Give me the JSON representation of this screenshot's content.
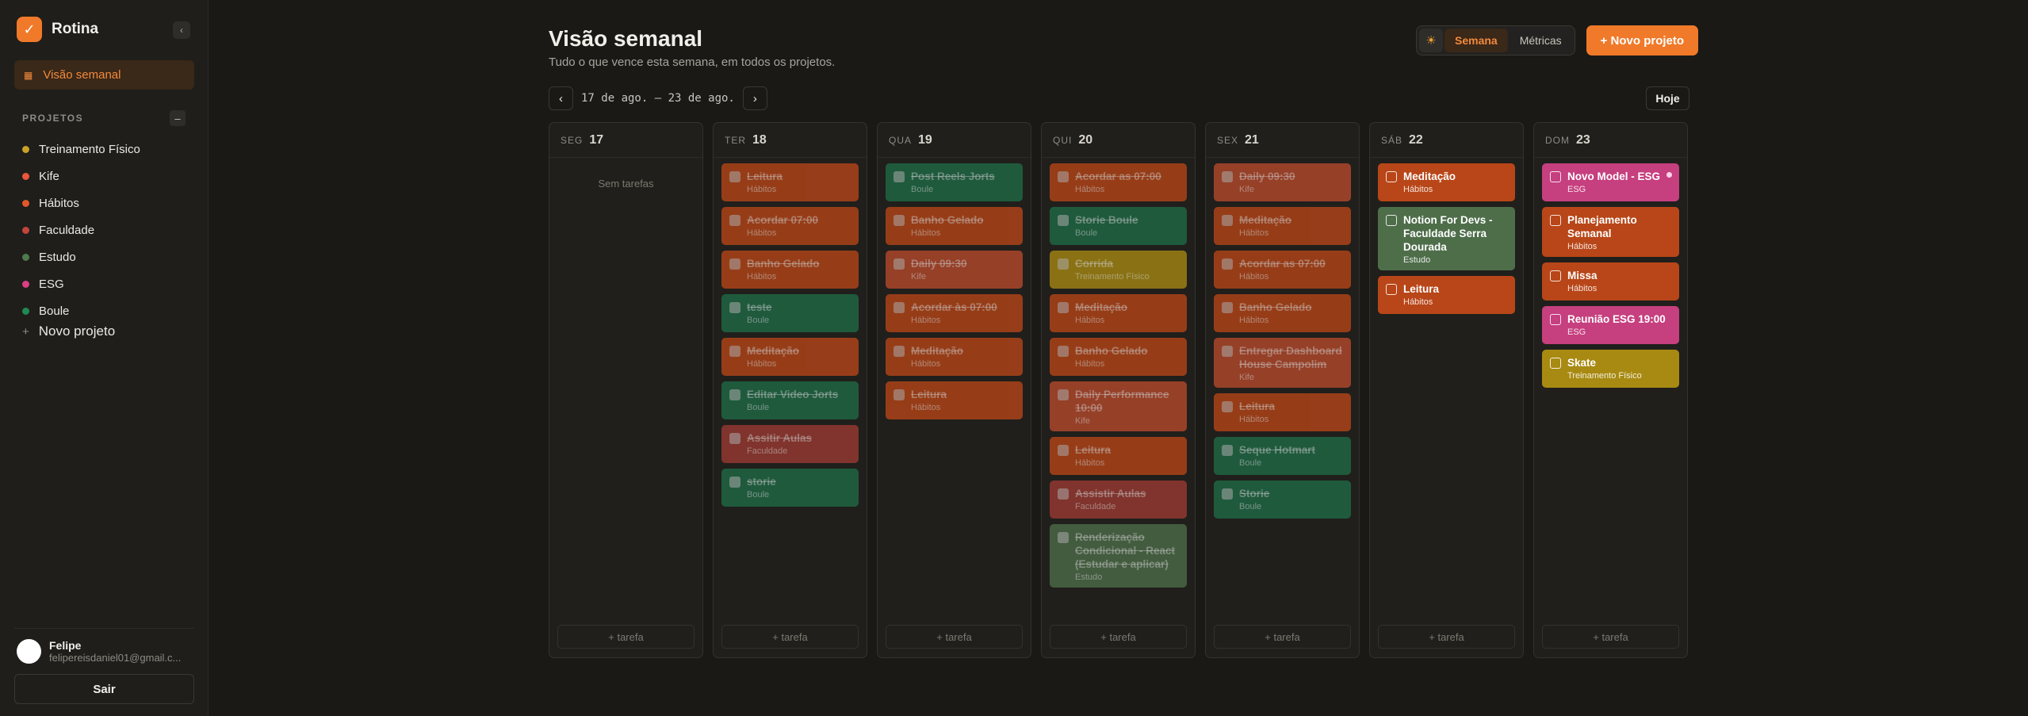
{
  "app": {
    "name": "Rotina",
    "logo_icon": "check-icon"
  },
  "sidebar": {
    "weekly_view_label": "Visão semanal",
    "projects_label": "PROJETOS",
    "projects": [
      {
        "name": "Treinamento Físico",
        "color": "#c9a227"
      },
      {
        "name": "Kife",
        "color": "#e8573a"
      },
      {
        "name": "Hábitos",
        "color": "#e2572a"
      },
      {
        "name": "Faculdade",
        "color": "#c2453d"
      },
      {
        "name": "Estudo",
        "color": "#4e7a4c"
      },
      {
        "name": "ESG",
        "color": "#db3f83"
      },
      {
        "name": "Boule",
        "color": "#1f8a52"
      }
    ],
    "new_project_label": "Novo projeto",
    "user": {
      "name": "Felipe",
      "email": "felipereisdaniel01@gmail.c..."
    },
    "logout_label": "Sair"
  },
  "header": {
    "title": "Visão semanal",
    "subtitle": "Tudo o que vence esta semana, em todos os projetos.",
    "tabs": [
      {
        "label": "Semana",
        "active": true
      },
      {
        "label": "Métricas",
        "active": false
      }
    ],
    "new_project_button": "+ Novo projeto",
    "range": "17 de ago. — 23 de ago.",
    "today_button": "Hoje"
  },
  "project_colors": {
    "Hábitos": "#b84618",
    "Boule": "#1f6b47",
    "Kife": "#b84a2c",
    "Faculdade": "#9c3b32",
    "Treinamento Físico": "#a88a12",
    "Estudo": "#4e6e4a",
    "ESG": "#c63f7f"
  },
  "add_task_label": "+ tarefa",
  "empty_label": "Sem tarefas",
  "days": [
    {
      "name": "SEG",
      "num": "17",
      "tasks": []
    },
    {
      "name": "TER",
      "num": "18",
      "tasks": [
        {
          "title": "Leitura",
          "project": "Hábitos",
          "done": true
        },
        {
          "title": "Acordar 07:00",
          "project": "Hábitos",
          "done": true
        },
        {
          "title": "Banho Gelado",
          "project": "Hábitos",
          "done": true
        },
        {
          "title": "teste",
          "project": "Boule",
          "done": true
        },
        {
          "title": "Meditação",
          "project": "Hábitos",
          "done": true
        },
        {
          "title": "Editar Video Jorts",
          "project": "Boule",
          "done": true
        },
        {
          "title": "Assitir Aulas",
          "project": "Faculdade",
          "done": true
        },
        {
          "title": "storie",
          "project": "Boule",
          "done": true
        }
      ]
    },
    {
      "name": "QUA",
      "num": "19",
      "tasks": [
        {
          "title": "Post Reels Jorts",
          "project": "Boule",
          "done": true
        },
        {
          "title": "Banho Gelado",
          "project": "Hábitos",
          "done": true
        },
        {
          "title": "Daily 09:30",
          "project": "Kife",
          "done": true
        },
        {
          "title": "Acordar às 07:00",
          "project": "Hábitos",
          "done": true
        },
        {
          "title": "Meditação",
          "project": "Hábitos",
          "done": true
        },
        {
          "title": "Leitura",
          "project": "Hábitos",
          "done": true
        }
      ]
    },
    {
      "name": "QUI",
      "num": "20",
      "tasks": [
        {
          "title": "Acordar as 07:00",
          "project": "Hábitos",
          "done": true
        },
        {
          "title": "Storie Boule",
          "project": "Boule",
          "done": true
        },
        {
          "title": "Corrida",
          "project": "Treinamento Físico",
          "done": true
        },
        {
          "title": "Meditação",
          "project": "Hábitos",
          "done": true
        },
        {
          "title": "Banho Gelado",
          "project": "Hábitos",
          "done": true
        },
        {
          "title": "Daily Performance 10:00",
          "project": "Kife",
          "done": true
        },
        {
          "title": "Leitura",
          "project": "Hábitos",
          "done": true
        },
        {
          "title": "Assistir Aulas",
          "project": "Faculdade",
          "done": true
        },
        {
          "title": "Renderização Condicional - React (Estudar e aplicar)",
          "project": "Estudo",
          "done": true
        }
      ]
    },
    {
      "name": "SEX",
      "num": "21",
      "tasks": [
        {
          "title": "Daily 09:30",
          "project": "Kife",
          "done": true
        },
        {
          "title": "Meditação",
          "project": "Hábitos",
          "done": true
        },
        {
          "title": "Acordar as 07:00",
          "project": "Hábitos",
          "done": true
        },
        {
          "title": "Banho Gelado",
          "project": "Hábitos",
          "done": true
        },
        {
          "title": "Entregar Dashboard House Campolim",
          "project": "Kife",
          "done": true
        },
        {
          "title": "Leitura",
          "project": "Hábitos",
          "done": true
        },
        {
          "title": "Seque Hotmart",
          "project": "Boule",
          "done": true
        },
        {
          "title": "Storie",
          "project": "Boule",
          "done": true
        }
      ]
    },
    {
      "name": "SÁB",
      "num": "22",
      "tasks": [
        {
          "title": "Meditação",
          "project": "Hábitos",
          "done": false
        },
        {
          "title": "Notion For Devs - Faculdade Serra Dourada",
          "project": "Estudo",
          "done": false
        },
        {
          "title": "Leitura",
          "project": "Hábitos",
          "done": false
        }
      ]
    },
    {
      "name": "DOM",
      "num": "23",
      "tasks": [
        {
          "title": "Novo Model - ESG",
          "project": "ESG",
          "done": false,
          "flag": true
        },
        {
          "title": "Planejamento Semanal",
          "project": "Hábitos",
          "done": false
        },
        {
          "title": "Missa",
          "project": "Hábitos",
          "done": false
        },
        {
          "title": "Reunião ESG 19:00",
          "project": "ESG",
          "done": false
        },
        {
          "title": "Skate",
          "project": "Treinamento Físico",
          "done": false
        }
      ]
    }
  ]
}
